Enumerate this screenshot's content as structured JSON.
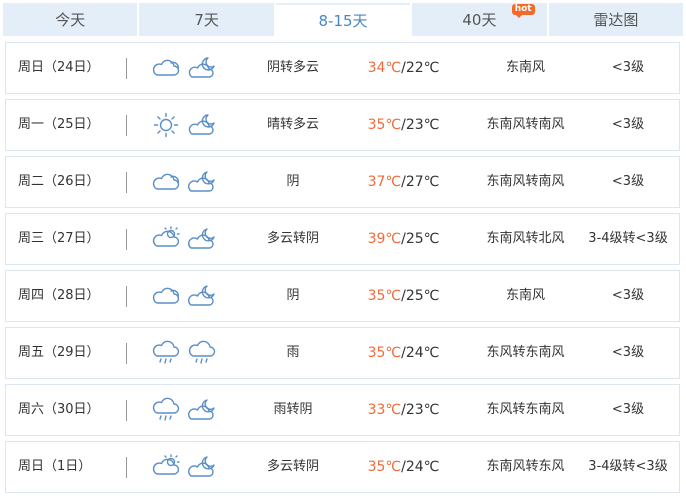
{
  "tabs": [
    {
      "label": "今天",
      "active": false
    },
    {
      "label": "7天",
      "active": false
    },
    {
      "label": "8-15天",
      "active": true
    },
    {
      "label": "40天",
      "active": false,
      "badge": "hot"
    },
    {
      "label": "雷达图",
      "active": false
    }
  ],
  "days": [
    {
      "day": "周日（24日）",
      "icon_day": "cloudy-icon",
      "icon_night": "partly-cloudy-night-icon",
      "condition": "阴转多云",
      "high": "34℃",
      "low": "22℃",
      "wind": "东南风",
      "level": "<3级"
    },
    {
      "day": "周一（25日）",
      "icon_day": "sunny-icon",
      "icon_night": "partly-cloudy-night-icon",
      "condition": "晴转多云",
      "high": "35℃",
      "low": "23℃",
      "wind": "东南风转南风",
      "level": "<3级"
    },
    {
      "day": "周二（26日）",
      "icon_day": "cloudy-icon",
      "icon_night": "cloudy-night-icon",
      "condition": "阴",
      "high": "37℃",
      "low": "27℃",
      "wind": "东南风转南风",
      "level": "<3级"
    },
    {
      "day": "周三（27日）",
      "icon_day": "partly-cloudy-day-icon",
      "icon_night": "cloudy-night-icon",
      "condition": "多云转阴",
      "high": "39℃",
      "low": "25℃",
      "wind": "东南风转北风",
      "level": "3-4级转<3级"
    },
    {
      "day": "周四（28日）",
      "icon_day": "cloudy-icon",
      "icon_night": "cloudy-night-icon",
      "condition": "阴",
      "high": "35℃",
      "low": "25℃",
      "wind": "东南风",
      "level": "<3级"
    },
    {
      "day": "周五（29日）",
      "icon_day": "rain-icon",
      "icon_night": "rain-icon",
      "condition": "雨",
      "high": "35℃",
      "low": "24℃",
      "wind": "东风转东南风",
      "level": "<3级"
    },
    {
      "day": "周六（30日）",
      "icon_day": "rain-icon",
      "icon_night": "cloudy-night-icon",
      "condition": "雨转阴",
      "high": "33℃",
      "low": "23℃",
      "wind": "东风转东南风",
      "level": "<3级"
    },
    {
      "day": "周日（1日）",
      "icon_day": "partly-cloudy-day-icon",
      "icon_night": "cloudy-night-icon",
      "condition": "多云转阴",
      "high": "35℃",
      "low": "24℃",
      "wind": "东南风转东风",
      "level": "3-4级转<3级"
    }
  ],
  "colors": {
    "accent": "#4a86c5",
    "tab_bg": "#e4eef9",
    "high_temp": "#f06a3a",
    "icon": "#5a8fc6",
    "border": "#dbe6f1"
  }
}
